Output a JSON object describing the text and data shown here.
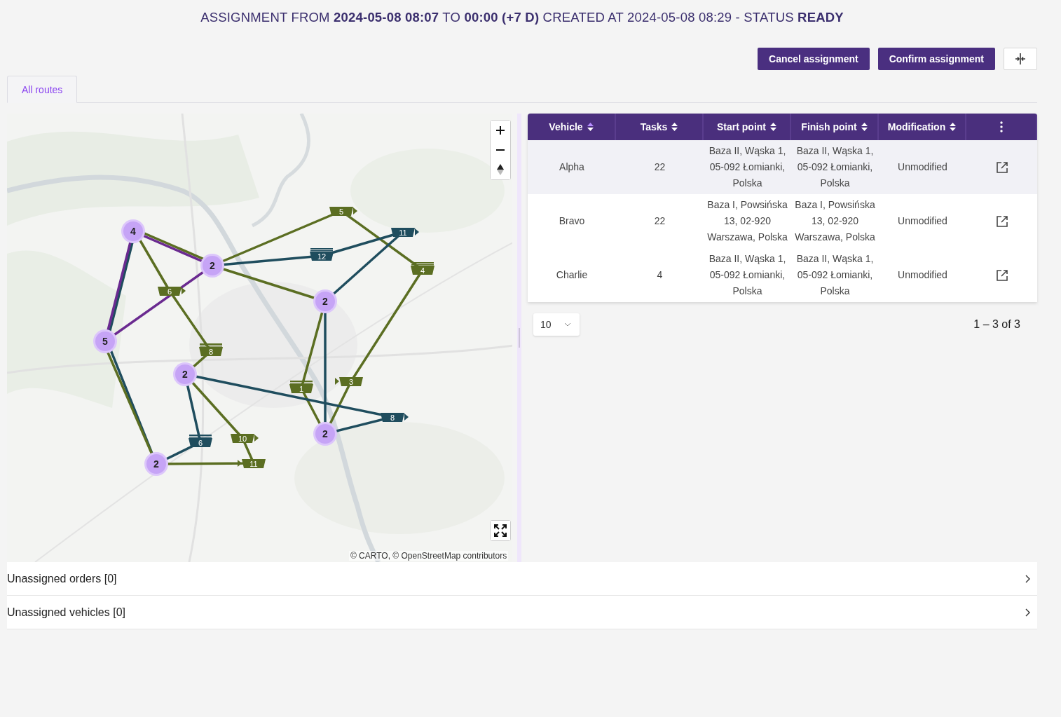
{
  "header": "ASSIGNMENT FROM **2024-05-08 08:07** TO **00:00 (+7 D)** CREATED AT 2024-05-08 08:29 - STATUS **READY**",
  "actions": [
    "Cancel assignment",
    "Confirm assignment"
  ],
  "tabs": [
    {
      "label": "All routes",
      "selected": true
    }
  ],
  "map": {
    "clusters": [
      {
        "label": "4"
      },
      {
        "label": "2"
      },
      {
        "label": "5"
      },
      {
        "label": "2"
      },
      {
        "label": "2"
      },
      {
        "label": "2"
      },
      {
        "label": "2"
      }
    ],
    "stops": [
      {
        "label": "5",
        "color": "#5b6e22",
        "kind": "arrow-right"
      },
      {
        "label": "11",
        "color": "#1f4d5e",
        "kind": "arrow-right"
      },
      {
        "label": "12",
        "color": "#1f4d5e",
        "kind": "stacked"
      },
      {
        "label": "4",
        "color": "#5b6e22",
        "kind": "stacked"
      },
      {
        "label": "6",
        "color": "#5b6e22",
        "kind": "arrow-right"
      },
      {
        "label": "8",
        "color": "#5b6e22",
        "kind": "stacked"
      },
      {
        "label": "1",
        "color": "#5b6e22",
        "kind": "stacked"
      },
      {
        "label": "3",
        "color": "#5b6e22",
        "kind": "arrow-left"
      },
      {
        "label": "8",
        "color": "#1f4d5e",
        "kind": "arrow-right"
      },
      {
        "label": "6",
        "color": "#1f4d5e",
        "kind": "stacked"
      },
      {
        "label": "10",
        "color": "#5b6e22",
        "kind": "arrow-right"
      },
      {
        "label": "11",
        "color": "#5b6e22",
        "kind": "arrow-left"
      }
    ],
    "routes": [
      {
        "color": "#5b6e22"
      },
      {
        "color": "#1f4d5e"
      },
      {
        "color": "#5b6e22"
      },
      {
        "color": "#6a2a90"
      }
    ],
    "attribution": "© CARTO, © OpenStreetMap contributors"
  },
  "table": {
    "columns": [
      {
        "label": "Vehicle",
        "sorted": true
      },
      {
        "label": "Tasks",
        "sorted": false
      },
      {
        "label": "Start point",
        "sorted": false
      },
      {
        "label": "Finish point",
        "sorted": false
      },
      {
        "label": "Modification",
        "sorted": false
      }
    ],
    "rows": [
      {
        "cells": [
          "Alpha",
          "22",
          "Baza II, Wąska 1, 05-092 Łomianki, Polska",
          "Baza II, Wąska 1, 05-092 Łomianki, Polska",
          "Unmodified"
        ],
        "selected": true
      },
      {
        "cells": [
          "Bravo",
          "22",
          "Baza I, Powsińska 13, 02-920 Warszawa, Polska",
          "Baza I, Powsińska 13, 02-920 Warszawa, Polska",
          "Unmodified"
        ],
        "selected": false
      },
      {
        "cells": [
          "Charlie",
          "4",
          "Baza II, Wąska 1, 05-092 Łomianki, Polska",
          "Baza II, Wąska 1, 05-092 Łomianki, Polska",
          "Unmodified"
        ],
        "selected": false
      }
    ],
    "page_size": "10",
    "range": "1 – 3 of 3"
  },
  "panels": [
    {
      "label": "Unassigned orders [0]"
    },
    {
      "label": "Unassigned vehicles [0]"
    }
  ]
}
